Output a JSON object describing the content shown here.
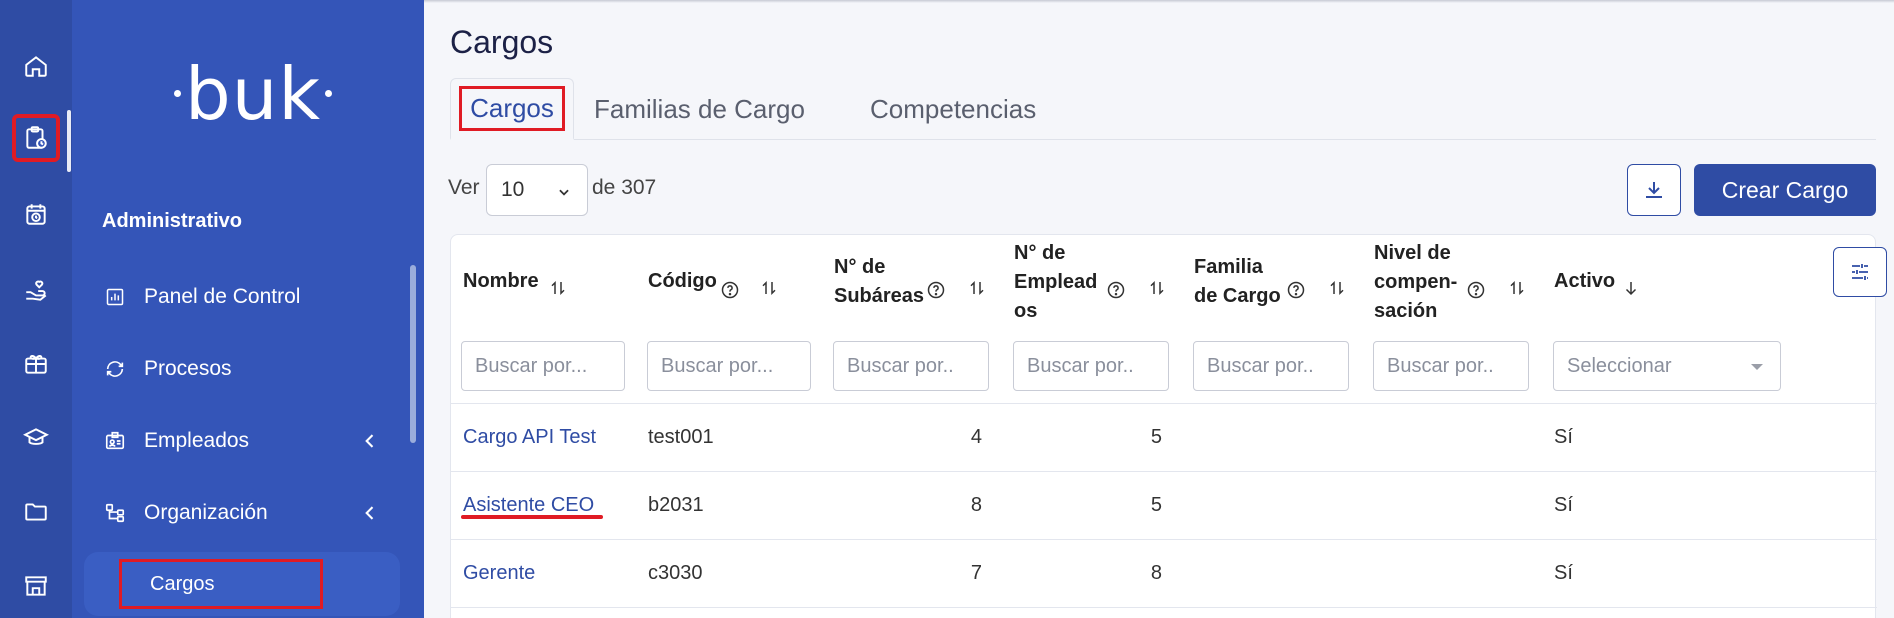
{
  "brand": {
    "logo_text": "buk"
  },
  "rail": {
    "icons": [
      "home-icon",
      "clipboard-clock-icon",
      "calendar-clock-icon",
      "hand-heart-icon",
      "gift-card-icon",
      "graduation-cap-icon",
      "folder-icon",
      "store-icon"
    ]
  },
  "sidebar": {
    "section_title": "Administrativo",
    "items": [
      {
        "label": "Panel de Control",
        "icon": "bar-chart-icon"
      },
      {
        "label": "Procesos",
        "icon": "refresh-icon"
      },
      {
        "label": "Empleados",
        "icon": "id-badge-icon",
        "has_children": true
      },
      {
        "label": "Organización",
        "icon": "org-tree-icon",
        "has_children": true
      }
    ],
    "subitem": {
      "label": "Cargos"
    }
  },
  "page": {
    "title": "Cargos",
    "tabs": [
      "Cargos",
      "Familias de Cargo",
      "Competencias"
    ],
    "active_tab": "Cargos"
  },
  "pagination": {
    "ver_label": "Ver",
    "page_size": "10",
    "of_label": "de 307"
  },
  "actions": {
    "create_label": "Crear Cargo"
  },
  "table": {
    "columns": [
      {
        "line1": "Nombre",
        "line2": "",
        "line3": "",
        "help": false
      },
      {
        "line1": "Código",
        "line2": "",
        "line3": "",
        "help": true
      },
      {
        "line1": "N° de",
        "line2": "Subáreas",
        "line3": "",
        "help": true
      },
      {
        "line1": "N° de",
        "line2": "Emplead",
        "line3": "os",
        "help": true
      },
      {
        "line1": "Familia",
        "line2": "de Cargo",
        "line3": "",
        "help": true
      },
      {
        "line1": "Nivel de",
        "line2": "compen-",
        "line3": "sación",
        "help": true
      },
      {
        "line1": "Activo",
        "line2": "",
        "line3": "",
        "help": false
      }
    ],
    "filters": [
      "Buscar por...",
      "Buscar por...",
      "Buscar por..",
      "Buscar por..",
      "Buscar por..",
      "Buscar por..",
      "Seleccionar"
    ],
    "rows": [
      {
        "nombre": "Cargo API Test",
        "codigo": "test001",
        "subareas": "4",
        "empleados": "5",
        "familia": "",
        "nivel": "",
        "activo": "Sí"
      },
      {
        "nombre": "Asistente CEO",
        "codigo": "b2031",
        "subareas": "8",
        "empleados": "5",
        "familia": "",
        "nivel": "",
        "activo": "Sí"
      },
      {
        "nombre": "Gerente",
        "codigo": "c3030",
        "subareas": "7",
        "empleados": "8",
        "familia": "",
        "nivel": "",
        "activo": "Sí"
      }
    ]
  },
  "colors": {
    "primary": "#2f4ca4",
    "sidebar": "#3455b8",
    "highlight": "#e01b24"
  }
}
